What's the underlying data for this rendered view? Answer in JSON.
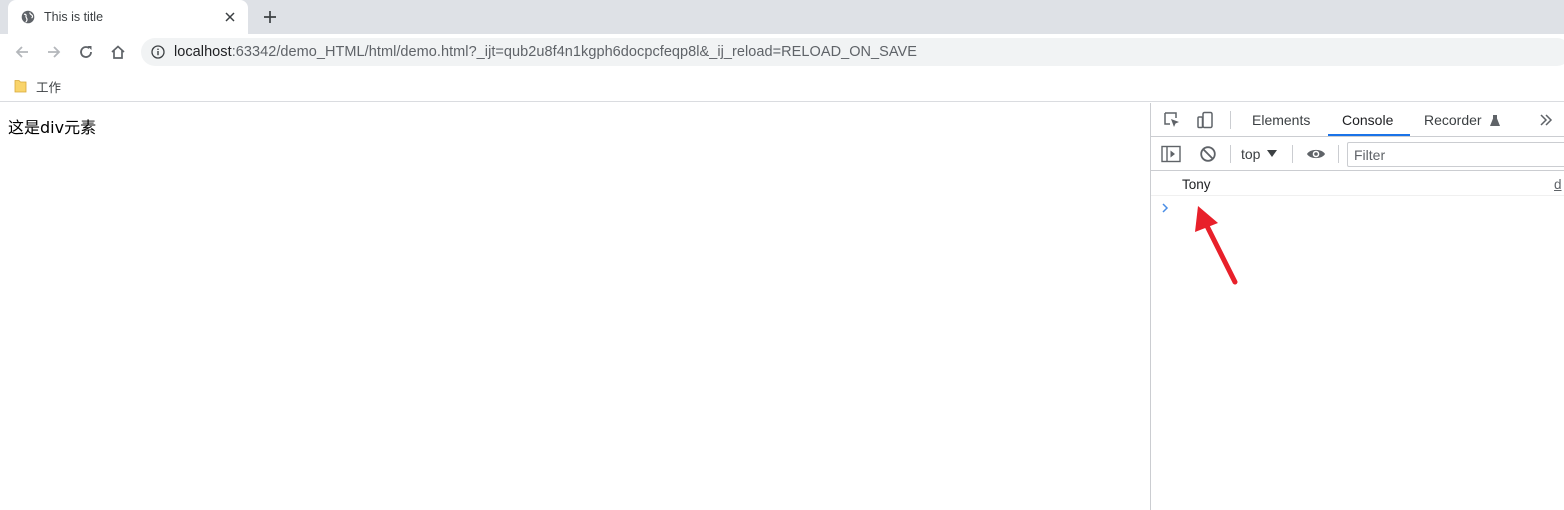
{
  "browser": {
    "tab": {
      "title": "This is title"
    },
    "address": {
      "host": "localhost",
      "rest": ":63342/demo_HTML/html/demo.html?_ijt=qub2u8f4n1kgph6docpcfeqp8l&_ij_reload=RELOAD_ON_SAVE"
    },
    "bookmarks": [
      {
        "label": "工作"
      }
    ]
  },
  "page": {
    "div_text": "这是div元素"
  },
  "devtools": {
    "tabs": [
      {
        "label": "Elements",
        "active": false
      },
      {
        "label": "Console",
        "active": true
      },
      {
        "label": "Recorder",
        "active": false
      }
    ],
    "context": "top",
    "filter_placeholder": "Filter",
    "console": {
      "messages": [
        {
          "text": "Tony",
          "source": "d"
        }
      ]
    }
  },
  "colors": {
    "accent": "#1a73e8",
    "annotation_arrow": "#e8202a"
  }
}
